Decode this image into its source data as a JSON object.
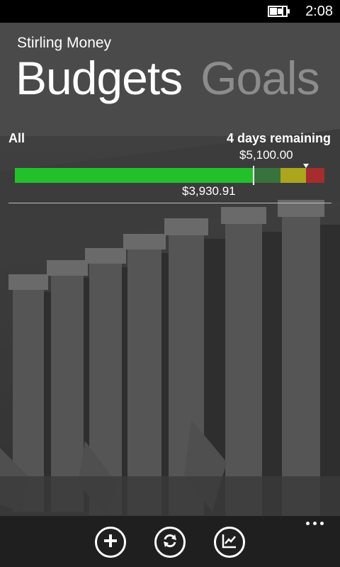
{
  "status_bar": {
    "time": "2:08",
    "battery_icon": "battery-charging-icon"
  },
  "app": {
    "title": "Stirling Money"
  },
  "pivot": {
    "items": [
      {
        "label": "Budgets",
        "active": true
      },
      {
        "label": "Goals",
        "active": false
      }
    ]
  },
  "budget": {
    "name": "All",
    "days_remaining": "4 days remaining",
    "budget_amount": "$5,100.00",
    "spent_amount": "$3,930.91",
    "spent_fraction": 0.771,
    "budget_fraction": 0.83,
    "colors": {
      "spent": "#22c12c",
      "on_track": "#32b43c",
      "warning": "#d2c814",
      "over": "#c82828"
    }
  },
  "app_bar": {
    "buttons": [
      {
        "icon": "add-icon"
      },
      {
        "icon": "sync-icon"
      },
      {
        "icon": "chart-icon"
      }
    ],
    "more_icon": "more-dots-icon"
  }
}
